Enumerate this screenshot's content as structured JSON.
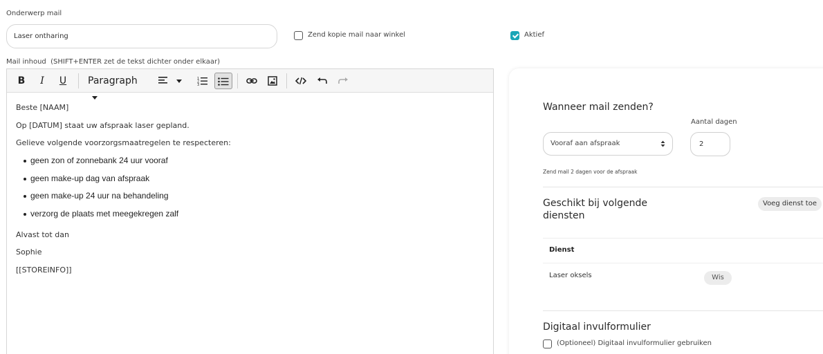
{
  "subject": {
    "label": "Onderwerp mail",
    "value": "Laser ontharing"
  },
  "copy_checkbox": {
    "label": "Zend kopie mail naar winkel",
    "checked": false
  },
  "active_checkbox": {
    "label": "Aktief",
    "checked": true
  },
  "mail_content_label": "Mail inhoud  (SHIFT+ENTER zet de tekst dichter onder elkaar)",
  "toolbar": {
    "bold": "B",
    "italic": "I",
    "underline": "U",
    "format_value": "Paragraph"
  },
  "editor": {
    "paragraphs_top": [
      "Beste [NAAM]",
      "Op [DATUM] staat uw afspraak laser gepland.",
      "Gelieve volgende voorzorgsmaatregelen te respecteren:"
    ],
    "bullets": [
      "geen zon of zonnebank 24 uur vooraf",
      "geen make-up dag van afspraak",
      "geen make-up 24 uur na behandeling",
      "verzorg de plaats met meegekregen zalf"
    ],
    "paragraphs_bottom": [
      "Alvast tot dan",
      "Sophie",
      "[[STOREINFO]]"
    ]
  },
  "send": {
    "title": "Wanneer mail zenden?",
    "days_label": "Aantal dagen",
    "timing_value": "Vooraf aan afspraak",
    "days_value": "2",
    "hint": "Zend mail 2 dagen voor de afspraak"
  },
  "services": {
    "title_line1": "Geschikt bij volgende",
    "title_line2": "diensten",
    "add_button": "Voeg dienst toe",
    "column_header": "Dienst",
    "rows": [
      {
        "name": "Laser oksels",
        "delete_label": "Wis"
      }
    ]
  },
  "form": {
    "title": "Digitaal invulformulier",
    "checkbox_label": "(Optioneel) Digitaal invulformulier gebruiken",
    "checked": false
  },
  "colors": {
    "accent": "#1aa6b7"
  }
}
